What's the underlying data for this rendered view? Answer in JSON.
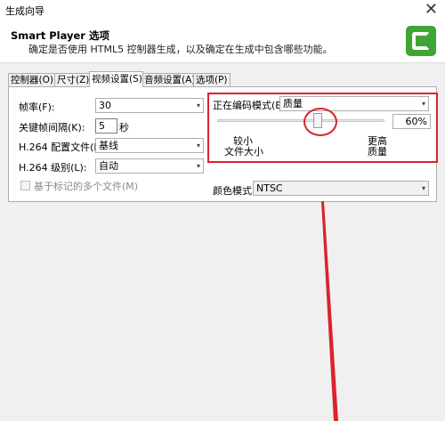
{
  "window": {
    "title": "生成向导",
    "close": "✕"
  },
  "header": {
    "title": "Smart Player 选项",
    "subtitle": "确定是否使用 HTML5 控制器生成，以及确定在生成中包含哪些功能。"
  },
  "tabs": [
    {
      "label": "控制器(O)",
      "active": false
    },
    {
      "label": "尺寸(Z)",
      "active": false
    },
    {
      "label": "视频设置(S)",
      "active": true
    },
    {
      "label": "音频设置(A)",
      "active": false
    },
    {
      "label": "选项(P)",
      "active": false
    }
  ],
  "video": {
    "framerate_label": "帧率(F):",
    "framerate_value": "30",
    "keyframe_label": "关键帧间隔(K):",
    "keyframe_value": "5",
    "keyframe_unit": "秒",
    "profile_label": "H.264 配置文件(R):",
    "profile_value": "基线",
    "level_label": "H.264 级别(L):",
    "level_value": "自动",
    "marker_checkbox_label": "基于标记的多个文件(M)",
    "marker_checked": false
  },
  "encoding": {
    "mode_label": "正在编码模式(E):",
    "mode_value": "质量",
    "quality_percent": "60%",
    "quality_fraction": 0.6,
    "low_label_1": "较小",
    "low_label_2": "文件大小",
    "high_label_1": "更高",
    "high_label_2": "质量"
  },
  "color": {
    "label": "颜色模式:",
    "value": "NTSC"
  },
  "colors": {
    "annotation": "#d9232d",
    "logo": "#3fa535"
  },
  "icons": {
    "dropdown": "▾",
    "close": "✕"
  }
}
